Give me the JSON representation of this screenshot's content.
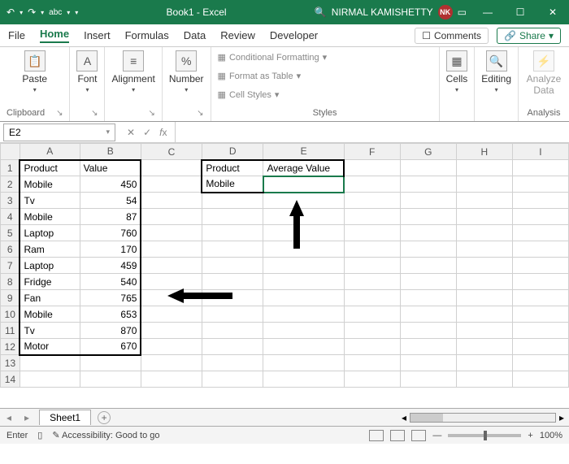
{
  "title": "Book1 - Excel",
  "user": {
    "name": "NIRMAL KAMISHETTY",
    "initials": "NK"
  },
  "tabs": {
    "file": "File",
    "home": "Home",
    "insert": "Insert",
    "formulas": "Formulas",
    "data": "Data",
    "review": "Review",
    "developer": "Developer"
  },
  "actions": {
    "comments": "Comments",
    "share": "Share"
  },
  "ribbon": {
    "clipboard": {
      "paste": "Paste",
      "label": "Clipboard"
    },
    "font": {
      "label": "Font"
    },
    "alignment": {
      "label": "Alignment"
    },
    "number": {
      "label": "Number"
    },
    "styles": {
      "cf": "Conditional Formatting",
      "ft": "Format as Table",
      "cs": "Cell Styles",
      "label": "Styles"
    },
    "cells": {
      "label": "Cells"
    },
    "editing": {
      "label": "Editing"
    },
    "analysis": {
      "analyze": "Analyze Data",
      "label": "Analysis"
    }
  },
  "namebox": "E2",
  "columns": [
    "A",
    "B",
    "C",
    "D",
    "E",
    "F",
    "G",
    "H",
    "I"
  ],
  "dataAB": {
    "headers": {
      "product": "Product",
      "value": "Value"
    },
    "rows": [
      {
        "p": "Mobile",
        "v": "450"
      },
      {
        "p": "Tv",
        "v": "54"
      },
      {
        "p": "Mobile",
        "v": "87"
      },
      {
        "p": "Laptop",
        "v": "760"
      },
      {
        "p": "Ram",
        "v": "170"
      },
      {
        "p": "Laptop",
        "v": "459"
      },
      {
        "p": "Fridge",
        "v": "540"
      },
      {
        "p": "Fan",
        "v": "765"
      },
      {
        "p": "Mobile",
        "v": "653"
      },
      {
        "p": "Tv",
        "v": "870"
      },
      {
        "p": "Motor",
        "v": "670"
      }
    ]
  },
  "dataDE": {
    "headers": {
      "product": "Product",
      "avg": "Average Value"
    },
    "rows": [
      {
        "p": "Mobile",
        "v": ""
      }
    ]
  },
  "sheettab": "Sheet1",
  "status": {
    "mode": "Enter",
    "access": "Accessibility: Good to go",
    "zoom": "100%"
  }
}
